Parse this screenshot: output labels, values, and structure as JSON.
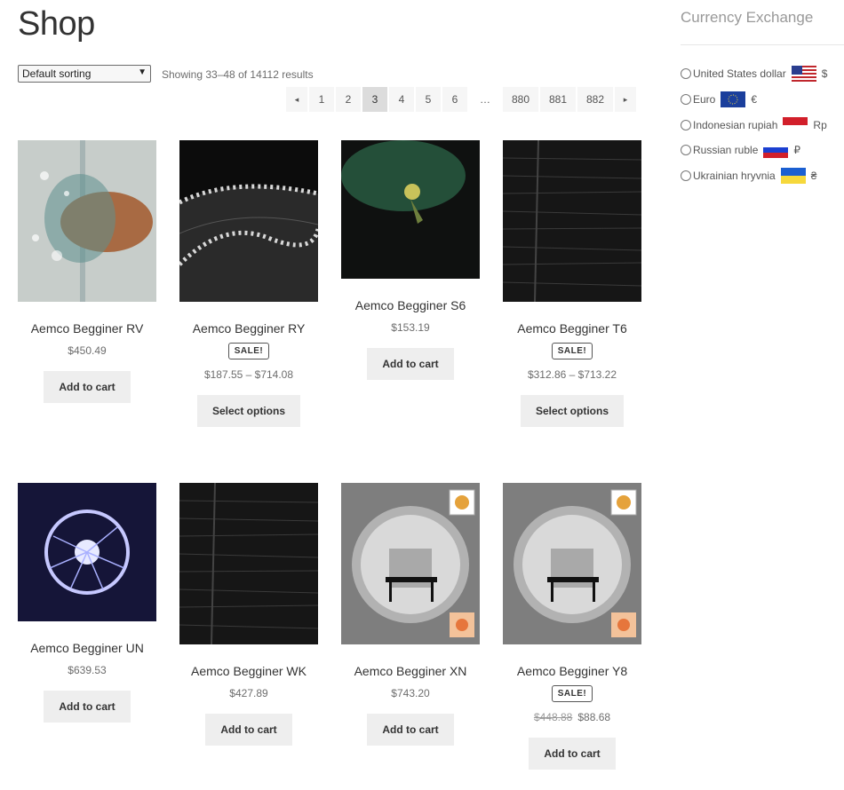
{
  "page": {
    "title": "Shop"
  },
  "toolbar": {
    "sorting_value": "Default sorting",
    "result_count": "Showing 33–48 of 14112 results"
  },
  "pagination": {
    "prev": "◂",
    "pages": [
      "1",
      "2",
      "3",
      "4",
      "5",
      "6",
      "…",
      "880",
      "881",
      "882"
    ],
    "next": "▸",
    "current": "3"
  },
  "products": [
    {
      "title": "Aemco Begginer RV",
      "price": "$450.49",
      "button": "Add to cart"
    },
    {
      "title": "Aemco Begginer RY",
      "sale_badge": "SALE!",
      "price": "$187.55 – $714.08",
      "button": "Select options"
    },
    {
      "title": "Aemco Begginer S6",
      "price": "$153.19",
      "button": "Add to cart"
    },
    {
      "title": "Aemco Begginer T6",
      "sale_badge": "SALE!",
      "price": "$312.86 – $713.22",
      "button": "Select options"
    },
    {
      "title": "Aemco Begginer UN",
      "price": "$639.53",
      "button": "Add to cart"
    },
    {
      "title": "Aemco Begginer WK",
      "price": "$427.89",
      "button": "Add to cart"
    },
    {
      "title": "Aemco Begginer XN",
      "price": "$743.20",
      "button": "Add to cart"
    },
    {
      "title": "Aemco Begginer Y8",
      "sale_badge": "SALE!",
      "old_price": "$448.88",
      "price": "$88.68",
      "button": "Add to cart"
    }
  ],
  "sidebar": {
    "widget_title": "Currency Exchange",
    "currencies": [
      {
        "name": "United States dollar",
        "symbol": "$",
        "flag": "us-flag"
      },
      {
        "name": "Euro",
        "symbol": "€",
        "flag": "eu-flag"
      },
      {
        "name": "Indonesian rupiah",
        "symbol": "Rp",
        "flag": "id-flag"
      },
      {
        "name": "Russian ruble",
        "symbol": "₽",
        "flag": "ru-flag"
      },
      {
        "name": "Ukrainian hryvnia",
        "symbol": "₴",
        "flag": "ua-flag"
      }
    ]
  },
  "colors": {
    "accent_button_bg": "#eeeeee",
    "text": "#333333",
    "muted": "#6d6d6d"
  }
}
